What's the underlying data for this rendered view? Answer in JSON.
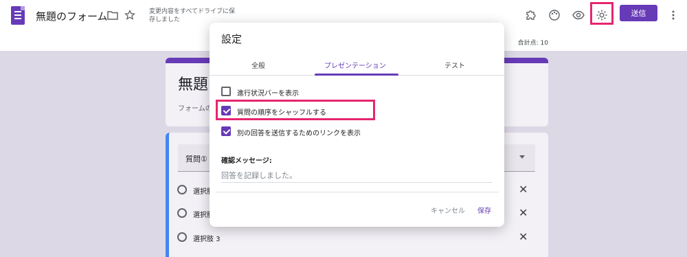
{
  "header": {
    "form_title": "無題のフォーム",
    "save_status": "変更内容をすべてドライブに保存しました",
    "send_label": "送信"
  },
  "subbar": {
    "total_points": "合計点: 10"
  },
  "form": {
    "title_partial": "無題",
    "description_partial": "フォームの",
    "question_title_partial": "質問①",
    "options": [
      {
        "label": "選択肢"
      },
      {
        "label": "選択肢"
      },
      {
        "label": "選択肢 3"
      }
    ]
  },
  "dialog": {
    "title": "設定",
    "tabs": [
      {
        "label": "全般",
        "active": false
      },
      {
        "label": "プレゼンテーション",
        "active": true
      },
      {
        "label": "テスト",
        "active": false
      }
    ],
    "checkboxes": [
      {
        "label": "進行状況バーを表示",
        "checked": false
      },
      {
        "label": "質問の順序をシャッフルする",
        "checked": true
      },
      {
        "label": "別の回答を送信するためのリンクを表示",
        "checked": true
      }
    ],
    "confirm_label": "確認メッセージ:",
    "confirm_placeholder": "回答を記録しました。",
    "cancel_label": "キャンセル",
    "save_label": "保存"
  },
  "colors": {
    "accent": "#673ab7",
    "highlight": "#e5266f"
  }
}
